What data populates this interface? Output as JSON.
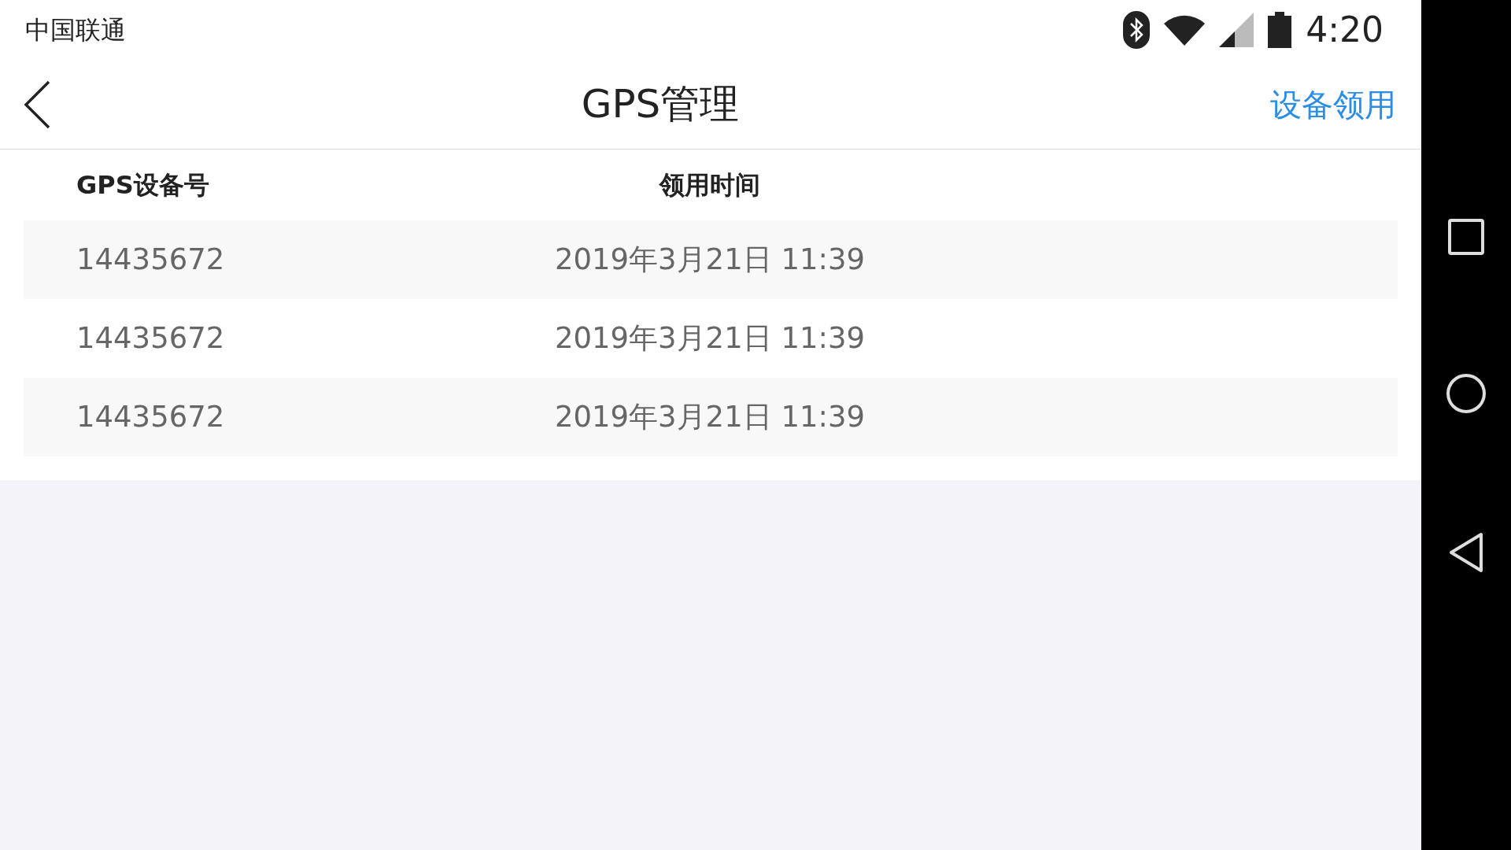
{
  "status_bar": {
    "carrier": "中国联通",
    "time": "4:20"
  },
  "header": {
    "title": "GPS管理",
    "action": "设备领用"
  },
  "table": {
    "columns": [
      "GPS设备号",
      "领用时间"
    ],
    "rows": [
      {
        "device_number": "14435672",
        "claimed_at": "2019年3月21日 11:39"
      },
      {
        "device_number": "14435672",
        "claimed_at": "2019年3月21日 11:39"
      },
      {
        "device_number": "14435672",
        "claimed_at": "2019年3月21日 11:39"
      }
    ]
  }
}
